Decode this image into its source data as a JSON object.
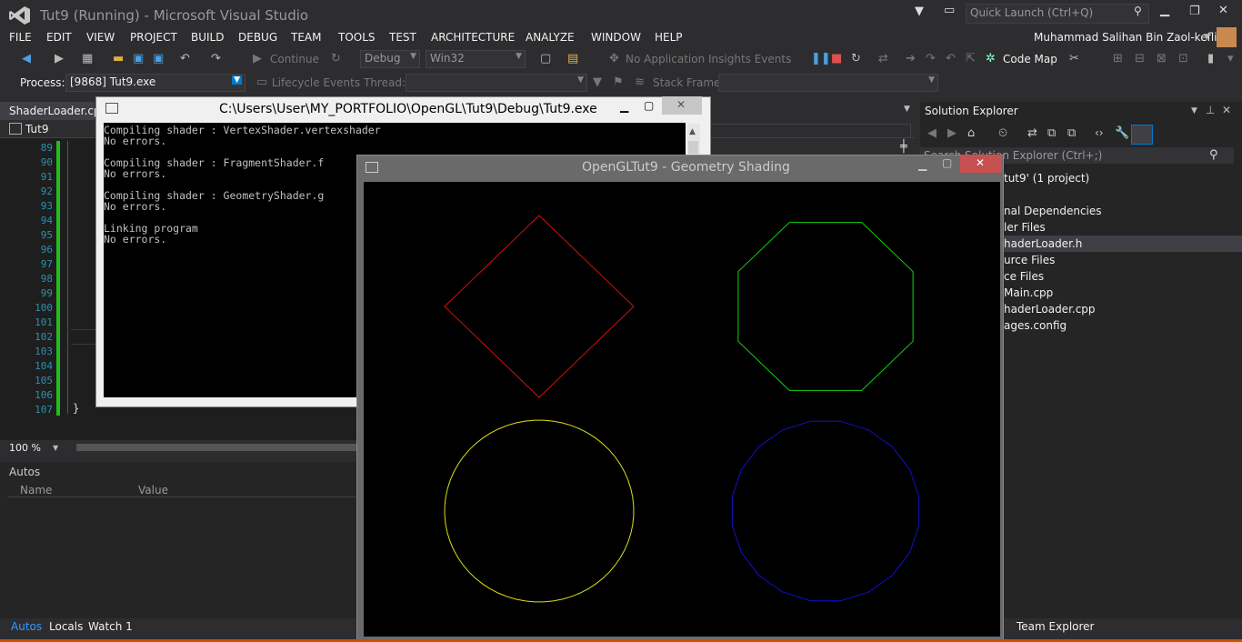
{
  "title": "Tut9 (Running) - Microsoft Visual Studio",
  "quick_launch": "Quick Launch (Ctrl+Q)",
  "menu": [
    "FILE",
    "EDIT",
    "VIEW",
    "PROJECT",
    "BUILD",
    "DEBUG",
    "TEAM",
    "TOOLS",
    "TEST",
    "ARCHITECTURE",
    "ANALYZE",
    "WINDOW",
    "HELP"
  ],
  "user": "Muhammad Salihan Bin Zaol-kefli",
  "toolbar": {
    "continue": "Continue",
    "config": "Debug",
    "platform": "Win32",
    "insights": "No Application Insights Events",
    "code_map": "Code Map",
    "process_label": "Process:",
    "process_value": "[9868] Tut9.exe",
    "lifecycle": "Lifecycle Events",
    "thread_label": "Thread:",
    "stack_label": "Stack Frame:"
  },
  "editor": {
    "file_tab": "ShaderLoader.cpp",
    "nav_combo": "Tut9",
    "line_numbers": [
      "89",
      "90",
      "91",
      "92",
      "93",
      "94",
      "95",
      "96",
      "97",
      "98",
      "99",
      "100",
      "101",
      "102",
      "103",
      "104",
      "105",
      "106",
      "107"
    ],
    "closing_brace": "}",
    "zoom": "100 %"
  },
  "autos": {
    "title": "Autos",
    "col_name": "Name",
    "col_value": "Value",
    "tabs": [
      "Autos",
      "Locals",
      "Watch 1"
    ]
  },
  "console": {
    "title": "C:\\Users\\User\\MY_PORTFOLIO\\OpenGL\\Tut9\\Debug\\Tut9.exe",
    "lines": [
      "Compiling shader : VertexShader.vertexshader",
      "No errors.",
      "",
      "Compiling shader : FragmentShader.f",
      "No errors.",
      "",
      "Compiling shader : GeometryShader.g",
      "No errors.",
      "",
      "Linking program",
      "No errors."
    ]
  },
  "gl": {
    "title": "OpenGLTut9 - Geometry Shading",
    "shapes": [
      {
        "shape": "diamond",
        "color": "#d01010",
        "sides": 4
      },
      {
        "shape": "octagon",
        "color": "#10d010",
        "sides": 8
      },
      {
        "shape": "circle",
        "color": "#e0e010",
        "sides": 64
      },
      {
        "shape": "polygon",
        "color": "#1010d0",
        "sides": 20
      }
    ]
  },
  "solution_explorer": {
    "title": "Solution Explorer",
    "search": "Search Solution Explorer (Ctrl+;)",
    "items": [
      "tut9' (1 project)",
      "nal Dependencies",
      "ler Files",
      "haderLoader.h",
      "urce Files",
      "ce Files",
      "Main.cpp",
      "haderLoader.cpp",
      "ages.config"
    ],
    "team_explorer": "Team Explorer"
  },
  "colors": {
    "accent": "#007acc",
    "status": "#ca5100"
  }
}
